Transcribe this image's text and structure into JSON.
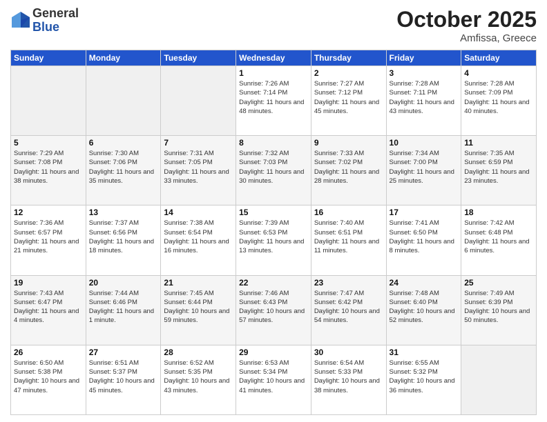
{
  "logo": {
    "general": "General",
    "blue": "Blue"
  },
  "header": {
    "month": "October 2025",
    "location": "Amfissa, Greece"
  },
  "days_of_week": [
    "Sunday",
    "Monday",
    "Tuesday",
    "Wednesday",
    "Thursday",
    "Friday",
    "Saturday"
  ],
  "weeks": [
    [
      {
        "day": "",
        "sunrise": "",
        "sunset": "",
        "daylight": ""
      },
      {
        "day": "",
        "sunrise": "",
        "sunset": "",
        "daylight": ""
      },
      {
        "day": "",
        "sunrise": "",
        "sunset": "",
        "daylight": ""
      },
      {
        "day": "1",
        "sunrise": "Sunrise: 7:26 AM",
        "sunset": "Sunset: 7:14 PM",
        "daylight": "Daylight: 11 hours and 48 minutes."
      },
      {
        "day": "2",
        "sunrise": "Sunrise: 7:27 AM",
        "sunset": "Sunset: 7:12 PM",
        "daylight": "Daylight: 11 hours and 45 minutes."
      },
      {
        "day": "3",
        "sunrise": "Sunrise: 7:28 AM",
        "sunset": "Sunset: 7:11 PM",
        "daylight": "Daylight: 11 hours and 43 minutes."
      },
      {
        "day": "4",
        "sunrise": "Sunrise: 7:28 AM",
        "sunset": "Sunset: 7:09 PM",
        "daylight": "Daylight: 11 hours and 40 minutes."
      }
    ],
    [
      {
        "day": "5",
        "sunrise": "Sunrise: 7:29 AM",
        "sunset": "Sunset: 7:08 PM",
        "daylight": "Daylight: 11 hours and 38 minutes."
      },
      {
        "day": "6",
        "sunrise": "Sunrise: 7:30 AM",
        "sunset": "Sunset: 7:06 PM",
        "daylight": "Daylight: 11 hours and 35 minutes."
      },
      {
        "day": "7",
        "sunrise": "Sunrise: 7:31 AM",
        "sunset": "Sunset: 7:05 PM",
        "daylight": "Daylight: 11 hours and 33 minutes."
      },
      {
        "day": "8",
        "sunrise": "Sunrise: 7:32 AM",
        "sunset": "Sunset: 7:03 PM",
        "daylight": "Daylight: 11 hours and 30 minutes."
      },
      {
        "day": "9",
        "sunrise": "Sunrise: 7:33 AM",
        "sunset": "Sunset: 7:02 PM",
        "daylight": "Daylight: 11 hours and 28 minutes."
      },
      {
        "day": "10",
        "sunrise": "Sunrise: 7:34 AM",
        "sunset": "Sunset: 7:00 PM",
        "daylight": "Daylight: 11 hours and 25 minutes."
      },
      {
        "day": "11",
        "sunrise": "Sunrise: 7:35 AM",
        "sunset": "Sunset: 6:59 PM",
        "daylight": "Daylight: 11 hours and 23 minutes."
      }
    ],
    [
      {
        "day": "12",
        "sunrise": "Sunrise: 7:36 AM",
        "sunset": "Sunset: 6:57 PM",
        "daylight": "Daylight: 11 hours and 21 minutes."
      },
      {
        "day": "13",
        "sunrise": "Sunrise: 7:37 AM",
        "sunset": "Sunset: 6:56 PM",
        "daylight": "Daylight: 11 hours and 18 minutes."
      },
      {
        "day": "14",
        "sunrise": "Sunrise: 7:38 AM",
        "sunset": "Sunset: 6:54 PM",
        "daylight": "Daylight: 11 hours and 16 minutes."
      },
      {
        "day": "15",
        "sunrise": "Sunrise: 7:39 AM",
        "sunset": "Sunset: 6:53 PM",
        "daylight": "Daylight: 11 hours and 13 minutes."
      },
      {
        "day": "16",
        "sunrise": "Sunrise: 7:40 AM",
        "sunset": "Sunset: 6:51 PM",
        "daylight": "Daylight: 11 hours and 11 minutes."
      },
      {
        "day": "17",
        "sunrise": "Sunrise: 7:41 AM",
        "sunset": "Sunset: 6:50 PM",
        "daylight": "Daylight: 11 hours and 8 minutes."
      },
      {
        "day": "18",
        "sunrise": "Sunrise: 7:42 AM",
        "sunset": "Sunset: 6:48 PM",
        "daylight": "Daylight: 11 hours and 6 minutes."
      }
    ],
    [
      {
        "day": "19",
        "sunrise": "Sunrise: 7:43 AM",
        "sunset": "Sunset: 6:47 PM",
        "daylight": "Daylight: 11 hours and 4 minutes."
      },
      {
        "day": "20",
        "sunrise": "Sunrise: 7:44 AM",
        "sunset": "Sunset: 6:46 PM",
        "daylight": "Daylight: 11 hours and 1 minute."
      },
      {
        "day": "21",
        "sunrise": "Sunrise: 7:45 AM",
        "sunset": "Sunset: 6:44 PM",
        "daylight": "Daylight: 10 hours and 59 minutes."
      },
      {
        "day": "22",
        "sunrise": "Sunrise: 7:46 AM",
        "sunset": "Sunset: 6:43 PM",
        "daylight": "Daylight: 10 hours and 57 minutes."
      },
      {
        "day": "23",
        "sunrise": "Sunrise: 7:47 AM",
        "sunset": "Sunset: 6:42 PM",
        "daylight": "Daylight: 10 hours and 54 minutes."
      },
      {
        "day": "24",
        "sunrise": "Sunrise: 7:48 AM",
        "sunset": "Sunset: 6:40 PM",
        "daylight": "Daylight: 10 hours and 52 minutes."
      },
      {
        "day": "25",
        "sunrise": "Sunrise: 7:49 AM",
        "sunset": "Sunset: 6:39 PM",
        "daylight": "Daylight: 10 hours and 50 minutes."
      }
    ],
    [
      {
        "day": "26",
        "sunrise": "Sunrise: 6:50 AM",
        "sunset": "Sunset: 5:38 PM",
        "daylight": "Daylight: 10 hours and 47 minutes."
      },
      {
        "day": "27",
        "sunrise": "Sunrise: 6:51 AM",
        "sunset": "Sunset: 5:37 PM",
        "daylight": "Daylight: 10 hours and 45 minutes."
      },
      {
        "day": "28",
        "sunrise": "Sunrise: 6:52 AM",
        "sunset": "Sunset: 5:35 PM",
        "daylight": "Daylight: 10 hours and 43 minutes."
      },
      {
        "day": "29",
        "sunrise": "Sunrise: 6:53 AM",
        "sunset": "Sunset: 5:34 PM",
        "daylight": "Daylight: 10 hours and 41 minutes."
      },
      {
        "day": "30",
        "sunrise": "Sunrise: 6:54 AM",
        "sunset": "Sunset: 5:33 PM",
        "daylight": "Daylight: 10 hours and 38 minutes."
      },
      {
        "day": "31",
        "sunrise": "Sunrise: 6:55 AM",
        "sunset": "Sunset: 5:32 PM",
        "daylight": "Daylight: 10 hours and 36 minutes."
      },
      {
        "day": "",
        "sunrise": "",
        "sunset": "",
        "daylight": ""
      }
    ]
  ]
}
